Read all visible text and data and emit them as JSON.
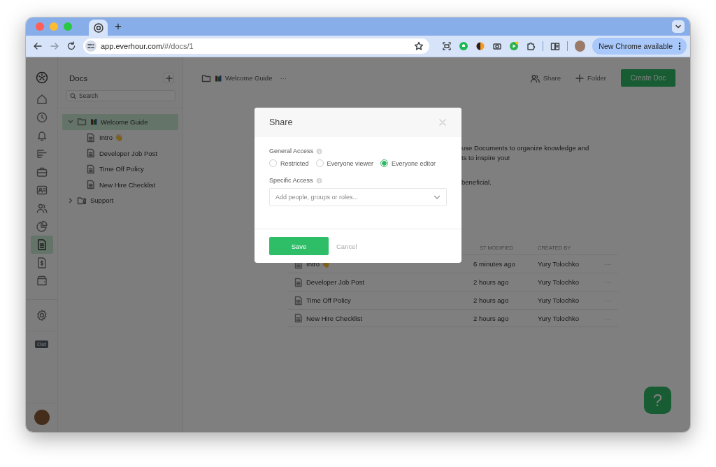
{
  "browser": {
    "tabs": [
      {
        "kind": "site",
        "selected": true
      }
    ],
    "new_tab": "+",
    "url_host": "app.everhour.com",
    "url_path": "/#/docs/1",
    "extensions": [
      {
        "kind": "screen"
      },
      {
        "kind": "green"
      },
      {
        "kind": "orange"
      },
      {
        "kind": "camera"
      },
      {
        "kind": "play"
      },
      {
        "kind": "puzzle"
      }
    ],
    "update_button": "New Chrome available"
  },
  "nav_rail": {
    "items": [
      {
        "kind": "home",
        "selected": false
      },
      {
        "kind": "clock",
        "selected": false
      },
      {
        "kind": "bell",
        "selected": false
      },
      {
        "kind": "gantt",
        "selected": false
      },
      {
        "kind": "briefcase",
        "selected": false
      },
      {
        "kind": "card",
        "selected": false
      },
      {
        "kind": "people",
        "selected": false
      },
      {
        "kind": "pie",
        "selected": false
      },
      {
        "kind": "doc",
        "selected": true
      },
      {
        "kind": "invoice",
        "selected": false
      },
      {
        "kind": "wallet",
        "selected": false
      }
    ],
    "status_badge": "Out"
  },
  "docs_panel": {
    "title": "Docs",
    "search": {
      "placeholder": "Search"
    },
    "tree": [
      {
        "label": "Welcome Guide",
        "kind": "folder",
        "expanded": true,
        "selected": true,
        "children": [
          {
            "label": "Intro 👋",
            "kind": "doc",
            "selected": false
          },
          {
            "label": "Developer Job Post",
            "kind": "doc",
            "selected": false
          },
          {
            "label": "Time Off Policy",
            "kind": "doc",
            "selected": false
          },
          {
            "label": "New Hire Checklist",
            "kind": "doc",
            "selected": false
          }
        ]
      },
      {
        "label": "Support",
        "kind": "locked-folder",
        "expanded": false,
        "selected": false
      }
    ]
  },
  "topbar": {
    "breadcrumb": "Welcome Guide",
    "more": "···",
    "share": "Share",
    "folder": "Folder",
    "create": "Create Doc"
  },
  "intro_fragments": [
    "use Documents to organize knowledge and",
    "ts to inspire you!",
    "beneficial."
  ],
  "table": {
    "columns": [
      "ST MODIFIED",
      "CREATED BY"
    ],
    "rows": [
      {
        "name": "Intro 👋",
        "modified": "6 minutes ago",
        "created_by": "Yury Tolochko",
        "more": "···"
      },
      {
        "name": "Developer Job Post",
        "modified": "2 hours ago",
        "created_by": "Yury Tolochko",
        "more": "···"
      },
      {
        "name": "Time Off Policy",
        "modified": "2 hours ago",
        "created_by": "Yury Tolochko",
        "more": "···"
      },
      {
        "name": "New Hire Checklist",
        "modified": "2 hours ago",
        "created_by": "Yury Tolochko",
        "more": "···"
      }
    ]
  },
  "modal": {
    "title": "Share",
    "general_access": "General Access",
    "options": [
      {
        "label": "Restricted",
        "selected": false
      },
      {
        "label": "Everyone viewer",
        "selected": false
      },
      {
        "label": "Everyone editor",
        "selected": true
      }
    ],
    "specific_access": "Specific Access",
    "select": {
      "placeholder": "Add people, groups or roles..."
    },
    "save": "Save",
    "cancel": "Cancel"
  },
  "help": "?"
}
